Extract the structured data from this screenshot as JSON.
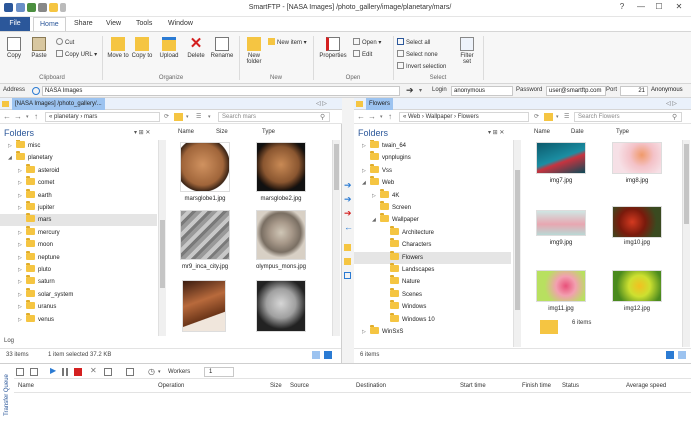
{
  "window": {
    "title": "SmartFTP - [NASA Images] /photo_gallery/image/planetary/mars/",
    "help": "?",
    "minimize": "—",
    "maximize": "☐",
    "close": "✕"
  },
  "ribbon_tabs": [
    "File",
    "Home",
    "Share",
    "View",
    "Tools",
    "Window"
  ],
  "ribbon": {
    "clipboard": {
      "copy": "Copy",
      "paste": "Paste",
      "cut": "Cut",
      "copy_url": "Copy URL",
      "label": "Clipboard"
    },
    "organize": {
      "move_to": "Move to",
      "copy_to": "Copy to",
      "upload": "Upload",
      "delete": "Delete",
      "rename": "Rename",
      "label": "Organize"
    },
    "new": {
      "new_folder": "New folder",
      "new_item": "New item",
      "label": "New"
    },
    "open": {
      "properties": "Properties",
      "open": "Open",
      "edit": "Edit",
      "label": "Open"
    },
    "select": {
      "select_all": "Select all",
      "select_none": "Select none",
      "invert": "Invert selection",
      "filter": "Filter set",
      "label": "Select"
    }
  },
  "address": {
    "label": "Address",
    "value": "NASA Images",
    "login_label": "Login",
    "login_value": "anonymous",
    "password_label": "Password",
    "password_value": "user@smartftp.com",
    "port_label": "Port",
    "port_value": "21",
    "mode_value": "Anonymous"
  },
  "left_pane": {
    "tab": "[NASA Images] /photo_gallery/...",
    "crumb": "« planetary › mars",
    "search_placeholder": "Search mars",
    "tree_title": "Folders",
    "tree": [
      {
        "label": "misc",
        "level": 1,
        "arrow": "▷"
      },
      {
        "label": "planetary",
        "level": 1,
        "arrow": "◢"
      },
      {
        "label": "asteroid",
        "level": 2,
        "arrow": "▷"
      },
      {
        "label": "comet",
        "level": 2,
        "arrow": "▷"
      },
      {
        "label": "earth",
        "level": 2,
        "arrow": "▷"
      },
      {
        "label": "jupiter",
        "level": 2,
        "arrow": "▷"
      },
      {
        "label": "mars",
        "level": 2,
        "arrow": "",
        "selected": true
      },
      {
        "label": "mercury",
        "level": 2,
        "arrow": "▷"
      },
      {
        "label": "moon",
        "level": 2,
        "arrow": "▷"
      },
      {
        "label": "neptune",
        "level": 2,
        "arrow": "▷"
      },
      {
        "label": "pluto",
        "level": 2,
        "arrow": "▷"
      },
      {
        "label": "saturn",
        "level": 2,
        "arrow": "▷"
      },
      {
        "label": "solar_system",
        "level": 2,
        "arrow": "▷"
      },
      {
        "label": "uranus",
        "level": 2,
        "arrow": "▷"
      },
      {
        "label": "venus",
        "level": 2,
        "arrow": "▷"
      }
    ],
    "columns": [
      "Name",
      "Size",
      "Type"
    ],
    "files": [
      "marsglobe1.jpg",
      "marsglobe2.jpg",
      "mr9_inca_city.jpg",
      "olympus_mons.jpg",
      "",
      ""
    ],
    "log_label": "Log",
    "status_items": "33 items",
    "status_selected": "1 item selected 37.2 KB"
  },
  "right_pane": {
    "tab": "Flowers",
    "crumb": "« Web › Wallpaper › Flowers",
    "search_placeholder": "Search Flowers",
    "tree_title": "Folders",
    "tree": [
      {
        "label": "twain_64",
        "level": 1,
        "arrow": "▷"
      },
      {
        "label": "vpnplugins",
        "level": 1,
        "arrow": ""
      },
      {
        "label": "Vss",
        "level": 1,
        "arrow": "▷"
      },
      {
        "label": "Web",
        "level": 1,
        "arrow": "◢"
      },
      {
        "label": "4K",
        "level": 2,
        "arrow": "▷"
      },
      {
        "label": "Screen",
        "level": 2,
        "arrow": ""
      },
      {
        "label": "Wallpaper",
        "level": 2,
        "arrow": "◢"
      },
      {
        "label": "Architecture",
        "level": 3,
        "arrow": ""
      },
      {
        "label": "Characters",
        "level": 3,
        "arrow": ""
      },
      {
        "label": "Flowers",
        "level": 3,
        "arrow": "",
        "selected": true
      },
      {
        "label": "Landscapes",
        "level": 3,
        "arrow": ""
      },
      {
        "label": "Nature",
        "level": 3,
        "arrow": ""
      },
      {
        "label": "Scenes",
        "level": 3,
        "arrow": ""
      },
      {
        "label": "Windows",
        "level": 3,
        "arrow": ""
      },
      {
        "label": "Windows 10",
        "level": 3,
        "arrow": ""
      },
      {
        "label": "WinSxS",
        "level": 1,
        "arrow": "▷"
      }
    ],
    "columns": [
      "Name",
      "Date",
      "Type"
    ],
    "files": [
      "img7.jpg",
      "img8.jpg",
      "img9.jpg",
      "img10.jpg",
      "img11.jpg",
      "img12.jpg"
    ],
    "folder_count": "6 items",
    "status_items": "6 items"
  },
  "transfer_queue": {
    "title": "Transfer Queue",
    "workers_label": "Workers",
    "workers_value": "1",
    "columns": [
      "Name",
      "Operation",
      "Size",
      "Source",
      "Destination",
      "Start time",
      "Finish time",
      "Status",
      "Average speed"
    ]
  },
  "colors": {
    "accent": "#2b579a",
    "folder": "#f5c542",
    "selection": "#e5e5e5"
  }
}
